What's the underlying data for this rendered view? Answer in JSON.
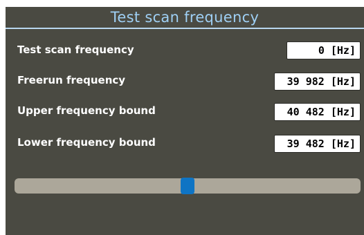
{
  "panel": {
    "title": "Test scan frequency"
  },
  "rows": [
    {
      "label": "Test scan frequency",
      "value": "0 [Hz]"
    },
    {
      "label": "Freerun frequency",
      "value": "39 982 [Hz]"
    },
    {
      "label": "Upper frequency bound",
      "value": "40 482 [Hz]"
    },
    {
      "label": "Lower frequency bound",
      "value": "39 482 [Hz]"
    }
  ],
  "slider": {
    "position_fraction": 0.5,
    "thumb_color": "#0e74c4",
    "track_color": "#aca79a"
  },
  "colors": {
    "panel_background": "#4a4a42",
    "title_text": "#9fd0f5",
    "title_underline": "#b9d7ef",
    "label_text": "#ffffff",
    "value_background": "#ffffff"
  }
}
